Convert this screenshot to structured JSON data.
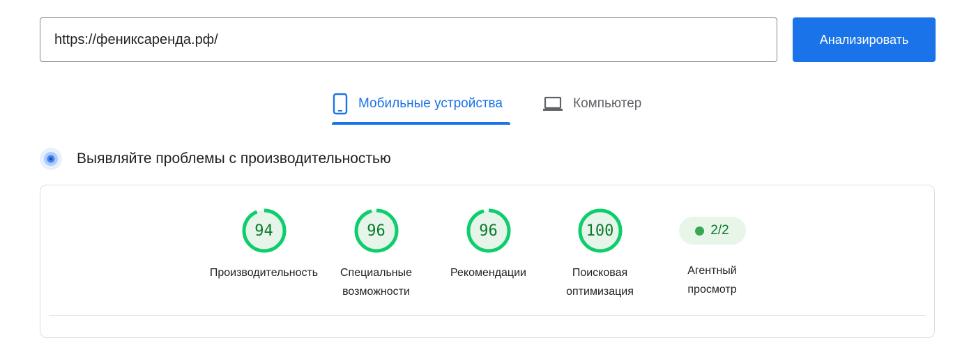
{
  "search": {
    "url": "https://фениксаренда.рф/"
  },
  "analyze_button": {
    "label": "Анализировать"
  },
  "tabs": [
    {
      "label": "Мобильные устройства",
      "icon": "smartphone-icon",
      "active": true
    },
    {
      "label": "Компьютер",
      "icon": "laptop-icon",
      "active": false
    }
  ],
  "section": {
    "title": "Выявляйте проблемы с производительностью",
    "icon": "performance-target-icon"
  },
  "scores": [
    {
      "label": "Производительность",
      "score": "94"
    },
    {
      "label": "Специальные\nвозможности",
      "score": "96"
    },
    {
      "label": "Рекомендации",
      "score": "96"
    },
    {
      "label": "Поисковая\nоптимизация",
      "score": "100"
    }
  ],
  "agent": {
    "label": "Агентный\nпросмотр",
    "score": "2/2"
  },
  "colors": {
    "accent": "#1a73e8",
    "pass": "#0cce6b",
    "pass_text": "#0c7a2e",
    "pass_bg": "#e8f5e9"
  }
}
